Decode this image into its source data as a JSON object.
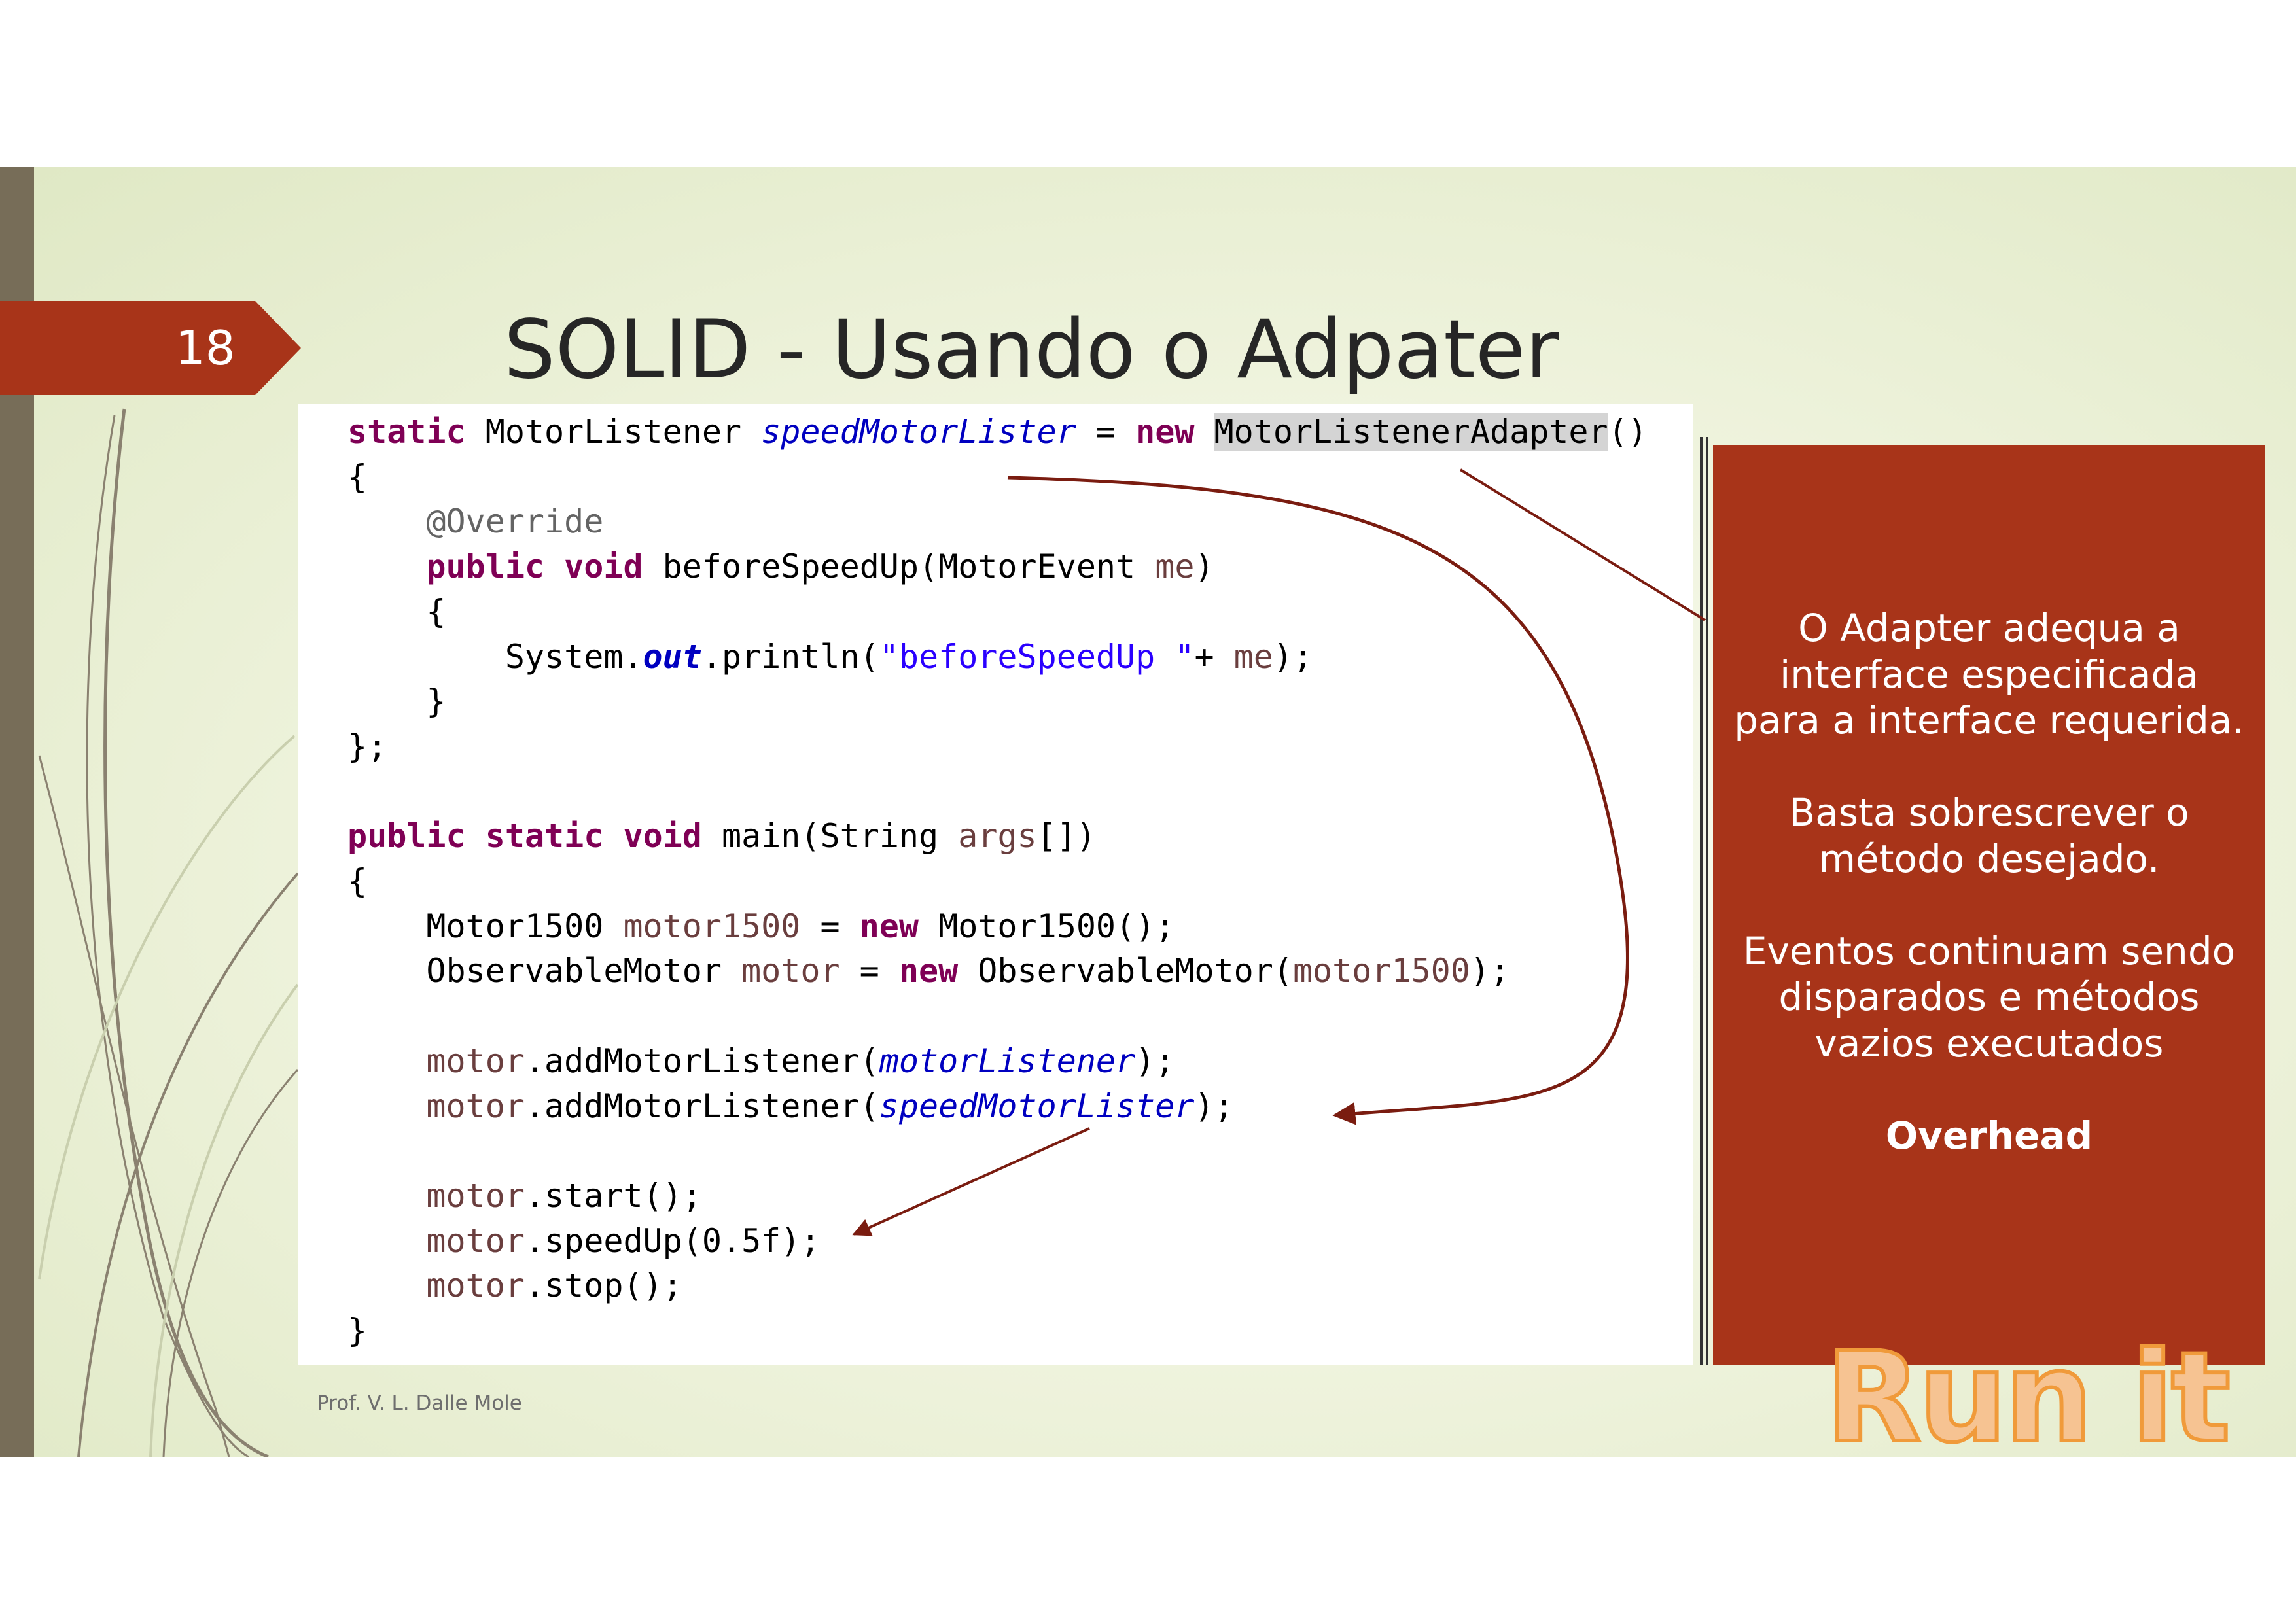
{
  "slide": {
    "number": "18",
    "title": "SOLID - Usando o Adpater",
    "footer": "Prof. V. L. Dalle Mole",
    "run_label": "Run it"
  },
  "code": {
    "lines": [
      [
        {
          "t": "static",
          "c": "kw"
        },
        {
          "t": " MotorListener "
        },
        {
          "t": "speedMotorLister",
          "c": "fld"
        },
        {
          "t": " = "
        },
        {
          "t": "new",
          "c": "kw"
        },
        {
          "t": " "
        },
        {
          "t": "MotorListenerAdapter",
          "c": "hl"
        },
        {
          "t": "()"
        }
      ],
      [
        {
          "t": "{"
        }
      ],
      [
        {
          "t": "    "
        },
        {
          "t": "@Override",
          "c": "ann"
        }
      ],
      [
        {
          "t": "    "
        },
        {
          "t": "public",
          "c": "kw"
        },
        {
          "t": " "
        },
        {
          "t": "void",
          "c": "kw"
        },
        {
          "t": " beforeSpeedUp(MotorEvent "
        },
        {
          "t": "me",
          "c": "var"
        },
        {
          "t": ")"
        }
      ],
      [
        {
          "t": "    {"
        }
      ],
      [
        {
          "t": "        System."
        },
        {
          "t": "out",
          "c": "fldb"
        },
        {
          "t": ".println("
        },
        {
          "t": "\"beforeSpeedUp \"",
          "c": "str"
        },
        {
          "t": "+ "
        },
        {
          "t": "me",
          "c": "var"
        },
        {
          "t": ");"
        }
      ],
      [
        {
          "t": "    }"
        }
      ],
      [
        {
          "t": "};"
        }
      ],
      [],
      [
        {
          "t": "public",
          "c": "kw"
        },
        {
          "t": " "
        },
        {
          "t": "static",
          "c": "kw"
        },
        {
          "t": " "
        },
        {
          "t": "void",
          "c": "kw"
        },
        {
          "t": " main(String "
        },
        {
          "t": "args",
          "c": "var"
        },
        {
          "t": "[])"
        }
      ],
      [
        {
          "t": "{"
        }
      ],
      [
        {
          "t": "    Motor1500 "
        },
        {
          "t": "motor1500",
          "c": "var"
        },
        {
          "t": " = "
        },
        {
          "t": "new",
          "c": "kw"
        },
        {
          "t": " Motor1500();"
        }
      ],
      [
        {
          "t": "    ObservableMotor "
        },
        {
          "t": "motor",
          "c": "var"
        },
        {
          "t": " = "
        },
        {
          "t": "new",
          "c": "kw"
        },
        {
          "t": " ObservableMotor("
        },
        {
          "t": "motor1500",
          "c": "var"
        },
        {
          "t": ");"
        }
      ],
      [],
      [
        {
          "t": "    "
        },
        {
          "t": "motor",
          "c": "var"
        },
        {
          "t": ".addMotorListener("
        },
        {
          "t": "motorListener",
          "c": "fld"
        },
        {
          "t": ");"
        }
      ],
      [
        {
          "t": "    "
        },
        {
          "t": "motor",
          "c": "var"
        },
        {
          "t": ".addMotorListener("
        },
        {
          "t": "speedMotorLister",
          "c": "fld"
        },
        {
          "t": ");"
        }
      ],
      [],
      [
        {
          "t": "    "
        },
        {
          "t": "motor",
          "c": "var"
        },
        {
          "t": ".start();"
        }
      ],
      [
        {
          "t": "    "
        },
        {
          "t": "motor",
          "c": "var"
        },
        {
          "t": ".speedUp(0.5f);"
        }
      ],
      [
        {
          "t": "    "
        },
        {
          "t": "motor",
          "c": "var"
        },
        {
          "t": ".stop();"
        }
      ],
      [
        {
          "t": "}"
        }
      ]
    ]
  },
  "note": {
    "paragraphs": [
      {
        "lines": [
          "O Adapter adequa a",
          "interface especificada",
          "para a interface requerida."
        ]
      },
      {
        "lines": [
          "Basta sobrescrever o",
          "método desejado."
        ]
      },
      {
        "lines": [
          "Eventos continuam sendo",
          "disparados e métodos",
          "vazios executados"
        ]
      },
      {
        "lines": [
          "Overhead"
        ],
        "bold": true
      }
    ]
  },
  "colors": {
    "accent": "#a83419",
    "left_bar": "#776d58",
    "arrow": "#7a1c10",
    "run_it_fill": "#f6c392",
    "run_it_stroke": "#f09a3a"
  }
}
